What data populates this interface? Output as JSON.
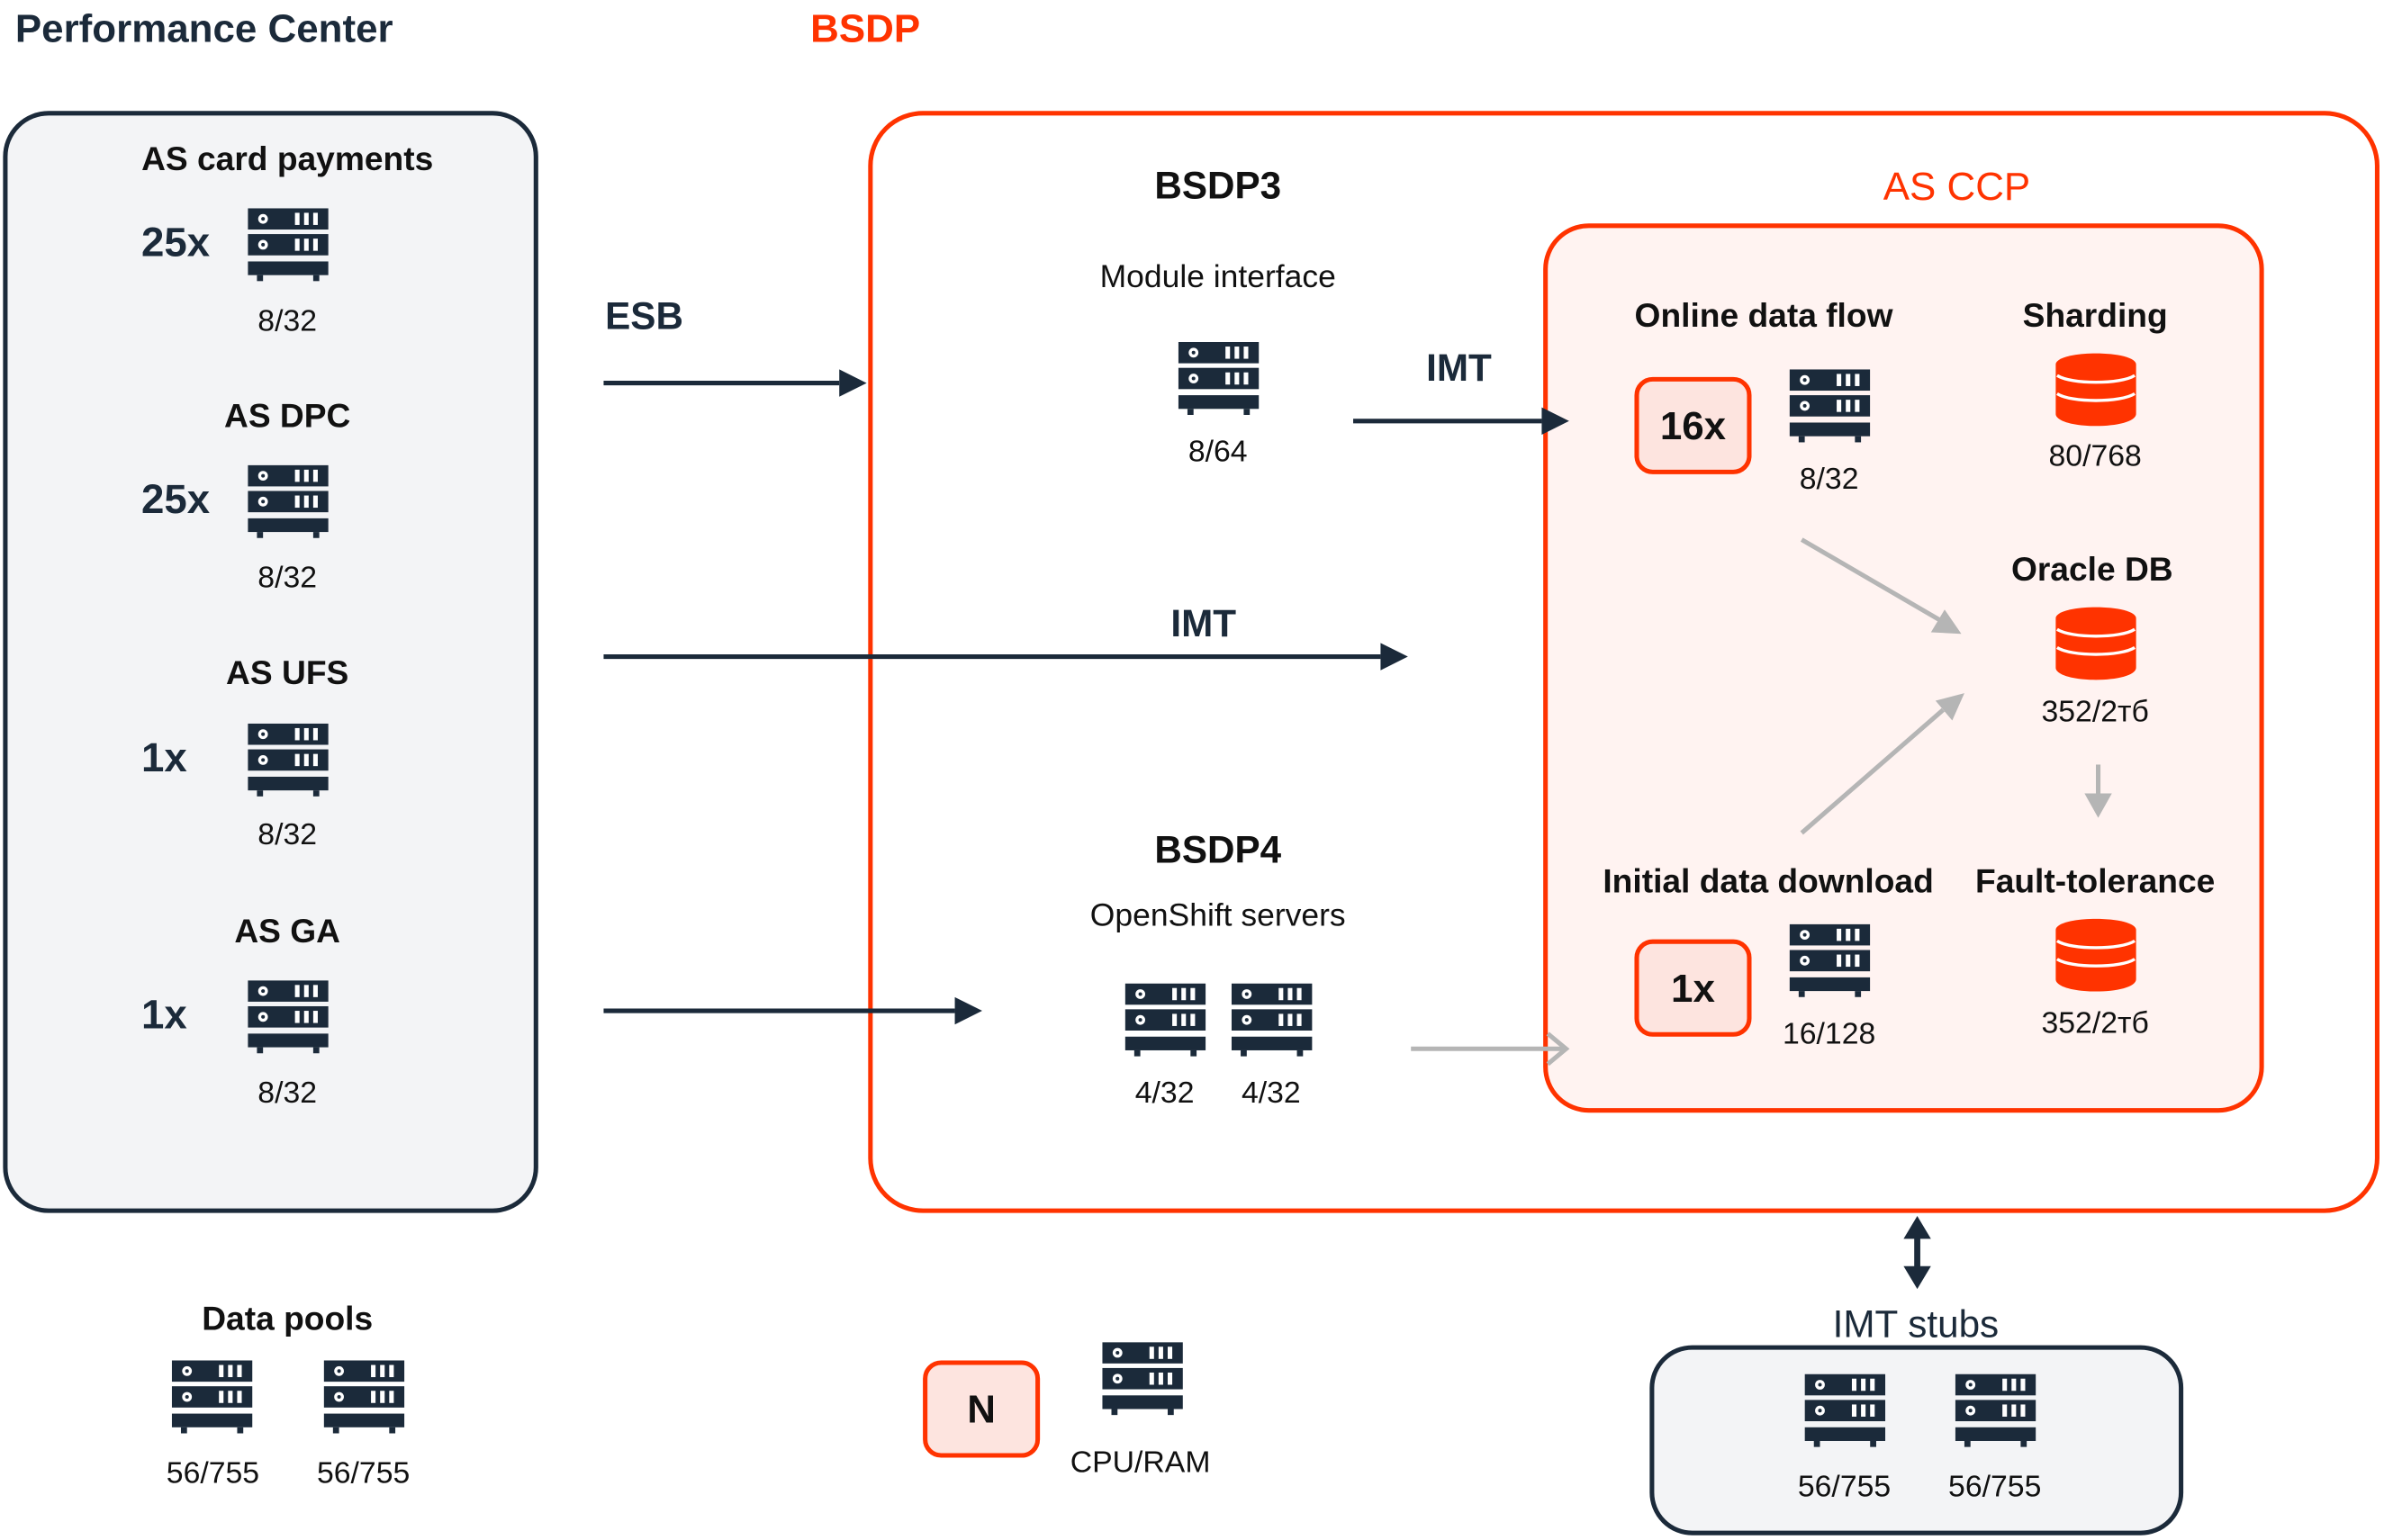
{
  "titles": {
    "left": "Performance Center",
    "right": "BSDP"
  },
  "left_panel": {
    "groups": [
      {
        "name": "AS card payments",
        "count": "25x",
        "spec": "8/32"
      },
      {
        "name": "AS DPC",
        "count": "25x",
        "spec": "8/32"
      },
      {
        "name": "AS UFS",
        "count": "1x",
        "spec": "8/32"
      },
      {
        "name": "AS GA",
        "count": "1x",
        "spec": "8/32"
      }
    ]
  },
  "connections": {
    "esb": "ESB",
    "imt_top": "IMT",
    "imt_mid": "IMT"
  },
  "bsdp3": {
    "title": "BSDP3",
    "subtitle": "Module interface",
    "spec": "8/64"
  },
  "bsdp4": {
    "title": "BSDP4",
    "subtitle": "OpenShift servers",
    "specs": [
      "4/32",
      "4/32"
    ]
  },
  "ccp": {
    "title": "AS CCP",
    "online": {
      "label": "Online data flow",
      "count": "16x",
      "spec": "8/32"
    },
    "initial": {
      "label": "Initial data download",
      "count": "1x",
      "spec": "16/128"
    },
    "sharding": {
      "label": "Sharding",
      "spec": "80/768"
    },
    "oracle": {
      "label": "Oracle DB",
      "spec": "352/2тб"
    },
    "fault": {
      "label": "Fault-tolerance",
      "spec": "352/2тб"
    }
  },
  "stubs": {
    "title": "IMT stubs",
    "specs": [
      "56/755",
      "56/755"
    ]
  },
  "data_pools": {
    "title": "Data pools",
    "specs": [
      "56/755",
      "56/755"
    ]
  },
  "legend": {
    "count_symbol": "N",
    "spec_label": "CPU/RAM"
  },
  "colors": {
    "accent": "#ff3300",
    "dark": "#1b2a3a",
    "panel": "#f3f4f6",
    "ccp_bg": "#fff3f1",
    "gray_arrow": "#b5b5b5"
  },
  "icons": {
    "server": "server-rack-icon",
    "database": "database-icon"
  }
}
